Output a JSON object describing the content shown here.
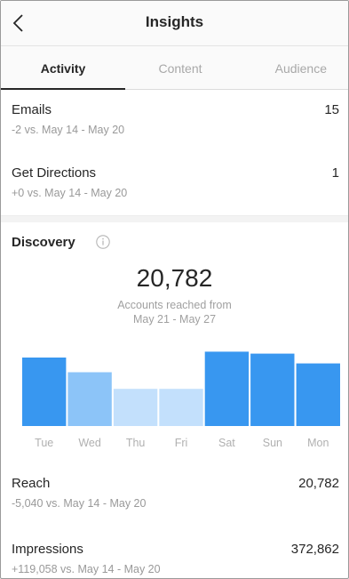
{
  "header": {
    "title": "Insights"
  },
  "tabs": [
    {
      "label": "Activity",
      "active": true
    },
    {
      "label": "Content",
      "active": false
    },
    {
      "label": "Audience",
      "active": false
    }
  ],
  "metrics_top": [
    {
      "label": "Emails",
      "value": "15",
      "sub": "-2 vs. May 14 - May 20"
    },
    {
      "label": "Get Directions",
      "value": "1",
      "sub": "+0 vs. May 14 - May 20"
    }
  ],
  "discovery": {
    "title": "Discovery",
    "info_icon": "info-circle-icon",
    "total": "20,782",
    "caption_line1": "Accounts reached from",
    "caption_line2": "May 21 - May 27"
  },
  "chart_data": {
    "type": "bar",
    "categories": [
      "Tue",
      "Wed",
      "Thu",
      "Fri",
      "Sat",
      "Sun",
      "Mon"
    ],
    "values": [
      70,
      55,
      38,
      38,
      76,
      74,
      64
    ],
    "ylim": [
      0,
      80
    ],
    "colors": [
      "#3897f0",
      "#8cc4f8",
      "#c3e0fc",
      "#c3e0fc",
      "#3897f0",
      "#3897f0",
      "#3897f0"
    ],
    "grid": false,
    "legend": "none"
  },
  "metrics_bottom": [
    {
      "label": "Reach",
      "value": "20,782",
      "sub": "-5,040 vs. May 14 - May 20"
    },
    {
      "label": "Impressions",
      "value": "372,862",
      "sub": "+119,058 vs. May 14 - May 20"
    }
  ],
  "colors": {
    "accent": "#3897f0",
    "text": "#262626",
    "muted": "#999999"
  }
}
